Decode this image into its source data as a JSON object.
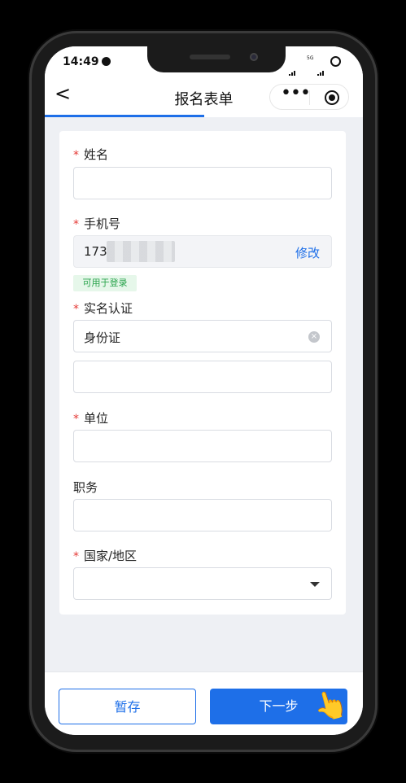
{
  "status_bar": {
    "time": "14:49",
    "sig1": "5G",
    "sig2": "5G"
  },
  "navbar": {
    "back": "<",
    "title": "报名表单",
    "more": "•••"
  },
  "progress": {
    "fraction": 0.5
  },
  "form": {
    "name": {
      "label": "姓名",
      "required_mark": "*",
      "value": ""
    },
    "phone": {
      "label": "手机号",
      "required_mark": "*",
      "value": "173",
      "action": "修改",
      "tag": "可用于登录"
    },
    "realname": {
      "label": "实名认证",
      "required_mark": "*",
      "id_type": "身份证",
      "clear_icon": "×",
      "id_number": ""
    },
    "company": {
      "label": "单位",
      "required_mark": "*",
      "value": ""
    },
    "position": {
      "label": "职务",
      "value": ""
    },
    "country": {
      "label": "国家/地区",
      "required_mark": "*",
      "value": ""
    }
  },
  "footer": {
    "save": "暂存",
    "next": "下一步"
  },
  "hand_glyph": "👆",
  "colors": {
    "accent": "#1e6fe8",
    "required": "#e53935",
    "tag_green": "#27a34a"
  }
}
